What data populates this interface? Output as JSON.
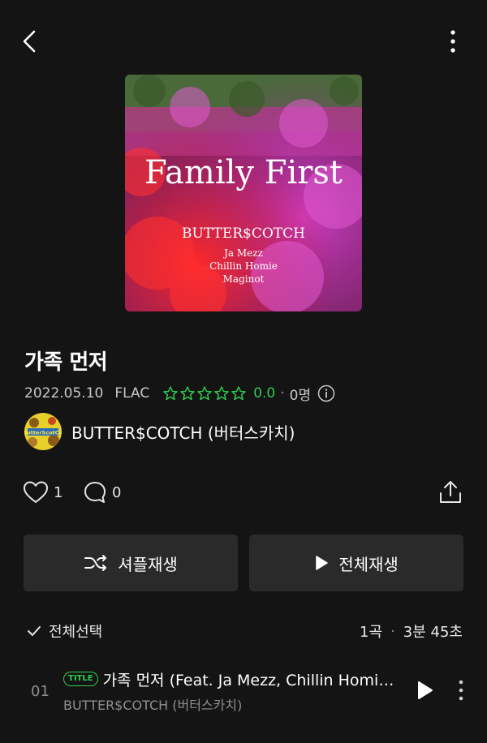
{
  "header": {
    "back_icon": "chevron-left-icon",
    "more_icon": "more-vertical-icon"
  },
  "album": {
    "cover": {
      "title_art": "Family First",
      "artist_art": "BUTTER$COTCH",
      "features_art": [
        "Ja Mezz",
        "Chillin Homie",
        "Maginot"
      ]
    },
    "title": "가족 먼저",
    "date": "2022.05.10",
    "format": "FLAC",
    "rating_value": "0.0",
    "rating_stars": 0,
    "rating_count": "0명",
    "accent_color": "#2fcc4f",
    "artist_name": "BUTTER$COTCH (버터스카치)",
    "avatar_art": "ButterScotCH"
  },
  "social": {
    "likes": "1",
    "comments": "0"
  },
  "actions": {
    "shuffle_label": "셔플재생",
    "play_all_label": "전체재생"
  },
  "tracklist": {
    "select_all_label": "전체선택",
    "count_label": "1곡",
    "duration_label": "3분 45초",
    "tracks": [
      {
        "number": "01",
        "badge": "TITLE",
        "title": "가족 먼저 (Feat. Ja Mezz, Chillin Homie, Maginot)",
        "artist": "BUTTER$COTCH (버터스카치)"
      }
    ]
  }
}
